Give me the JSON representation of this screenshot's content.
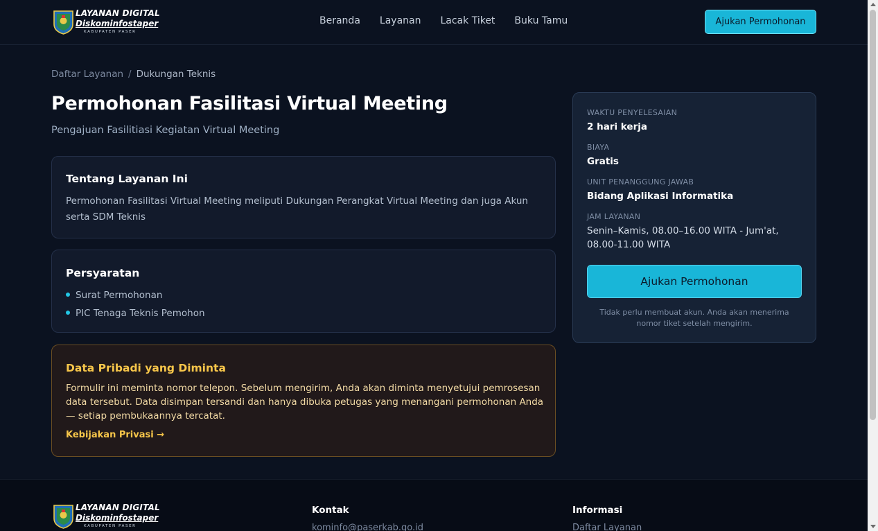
{
  "brand": {
    "line1": "LAYANAN DIGITAL",
    "line2": "Diskominfostaper",
    "line3": "KABUPATEN PASER"
  },
  "nav": {
    "items": [
      "Beranda",
      "Layanan",
      "Lacak Tiket",
      "Buku Tamu"
    ],
    "cta": "Ajukan Permohonan"
  },
  "breadcrumb": {
    "parent": "Daftar Layanan",
    "separator": "/",
    "current": "Dukungan Teknis"
  },
  "page": {
    "title": "Permohonan Fasilitasi Virtual Meeting",
    "subtitle": "Pengajuan Fasilitiasi Kegiatan Virtual Meeting"
  },
  "about": {
    "heading": "Tentang Layanan Ini",
    "text": "Permohonan Fasilitasi Virtual Meeting meliputi Dukungan Perangkat Virtual Meeting dan juga Akun serta SDM Teknis"
  },
  "requirements": {
    "heading": "Persyaratan",
    "items": [
      "Surat Permohonan",
      "PIC Tenaga Teknis Pemohon"
    ]
  },
  "privacy": {
    "heading": "Data Pribadi yang Diminta",
    "text": "Formulir ini meminta nomor telepon. Sebelum mengirim, Anda akan diminta menyetujui pemrosesan data tersebut. Data disimpan tersandi dan hanya dibuka petugas yang menangani permohonan Anda — setiap pembukaannya tercatat.",
    "link": "Kebijakan Privasi →"
  },
  "sidebar": {
    "time_label": "WAKTU PENYELESAIAN",
    "time_value": "2 hari kerja",
    "cost_label": "BIAYA",
    "cost_value": "Gratis",
    "unit_label": "UNIT PENANGGUNG JAWAB",
    "unit_value": "Bidang Aplikasi Informatika",
    "hours_label": "JAM LAYANAN",
    "hours_value": "Senin–Kamis, 08.00–16.00 WITA - Jum'at, 08.00-11.00 WITA",
    "cta": "Ajukan Permohonan",
    "note": "Tidak perlu membuat akun. Anda akan menerima nomor tiket setelah mengirim."
  },
  "footer": {
    "contact_title": "Kontak",
    "contact_email": "kominfo@paserkab.go.id",
    "info_title": "Informasi",
    "info_item": "Daftar Layanan"
  },
  "colors": {
    "background": "#0b1220",
    "accent": "#19b6d8",
    "warning": "#f7c64a"
  }
}
